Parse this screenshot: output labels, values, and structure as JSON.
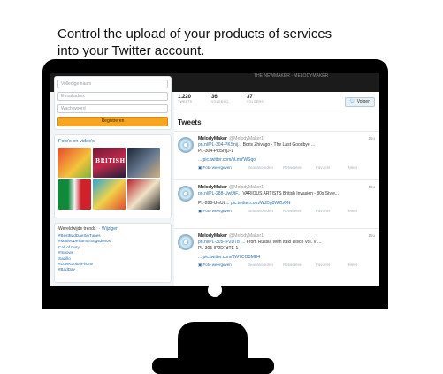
{
  "headline": {
    "line1": "Control the upload of your products of services",
    "line2": "into your Twitter account."
  },
  "topbar": {
    "handle_text": "THE NEWMAKER · MELODYMAKER"
  },
  "signup": {
    "name_placeholder": "Volledige naam",
    "email_placeholder": "E-mailadres",
    "password_placeholder": "Wachtwoord",
    "register_button": "Registreren"
  },
  "photos": {
    "title": "Foto's en video's",
    "thumb_caption": "BRITISH"
  },
  "trends": {
    "title": "Wereldwijde trends",
    "change_link": "· Wijzigen",
    "items": [
      "#BestBadDaeSinTunes",
      "#MadeoDeSamarSegsdonos",
      "Call of Duty",
      "#mnowe",
      "Sadillo",
      "#LoveGlobalPhone",
      "#BadDay"
    ]
  },
  "stats": {
    "tweets": {
      "num": "1.220",
      "label": "TWEETS"
    },
    "following": {
      "num": "36",
      "label": "VOLGEND"
    },
    "followers": {
      "num": "37",
      "label": "VOLGERS"
    },
    "follow_button": "Volgen"
  },
  "tweets_heading": "Tweets",
  "tweets": [
    {
      "name": "MelodyMaker",
      "handle": "@MelodyMaker1",
      "time": "15u",
      "link": "pn.nl/PL-304-PKSnij...",
      "text": "Boris Zhivago - The Last Goodbye ...",
      "line2": "PL-304-PkiSnijJ-1",
      "line3_link": "... pic.twitter.com/sLmYWSqo",
      "line3_text": "",
      "photo_link": "Foto weergeven",
      "actions": [
        "Beantwoorden",
        "Retweeten",
        "Favoriet",
        "Meer"
      ]
    },
    {
      "name": "MelodyMaker",
      "handle": "@MelodyMaker1",
      "time": "15u",
      "link": "pn.nl/PL-288-UwUtF...",
      "text": "VARIOUS ARTISTS British Invasion - 80s Style...",
      "line2": "",
      "line3_link": "pic.twitter.com/WJDg0WZbON",
      "line3_text": "PL-288-UwUt ...",
      "photo_link": "Foto weergeven",
      "actions": [
        "Beantwoorden",
        "Retweeten",
        "Favoriet",
        "Meer"
      ]
    },
    {
      "name": "MelodyMaker",
      "handle": "@MelodyMaker1",
      "time": "15u",
      "link": "pn.nl/PL-305-IP2D7dT...",
      "text": "From Russia With Italo Disco Vol. VI...",
      "line2": "PL-305-IP2D7dTE-1",
      "line3_link": "... pic.twitter.com/3W7COBMD4",
      "line3_text": "",
      "photo_link": "Foto weergeven",
      "actions": [
        "Beantwoorden",
        "Retweeten",
        "Favoriet",
        "Meer"
      ]
    }
  ],
  "colors": {
    "monitor": "#000000",
    "register_button": "#f6a623",
    "link": "#2a6ea8",
    "screen_bg": "#f2f5f7"
  }
}
